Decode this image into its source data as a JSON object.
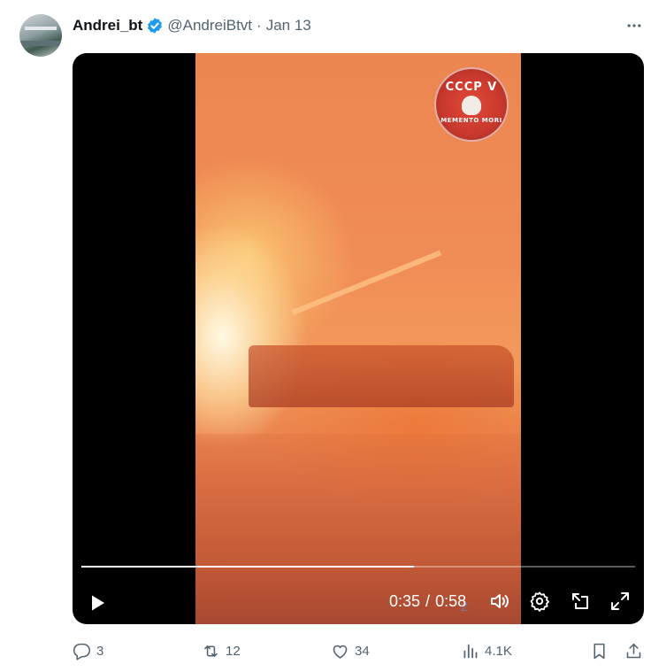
{
  "post": {
    "author_name": "Andrei_bt",
    "handle": "@AndreiBtvt",
    "separator": "·",
    "date": "Jan 13",
    "verified_color": "#1d9bf0"
  },
  "video": {
    "current_time": "0:35",
    "time_separator": "/",
    "duration": "0:58",
    "progress_fraction": 0.6,
    "logo_text_top": "CCCP V",
    "logo_text_bottom": "MEMENTO MORI",
    "watermark_text": "Z"
  },
  "actions": {
    "replies": "3",
    "reposts": "12",
    "likes": "34",
    "views": "4.1K"
  },
  "icons": {
    "more": "more-icon",
    "play": "play-icon",
    "volume": "volume-icon",
    "settings": "settings-gear-icon",
    "pip": "picture-in-picture-icon",
    "fullscreen": "fullscreen-icon",
    "reply": "reply-icon",
    "repost": "repost-icon",
    "like": "heart-icon",
    "views": "views-bar-chart-icon",
    "bookmark": "bookmark-icon",
    "share": "share-icon"
  }
}
